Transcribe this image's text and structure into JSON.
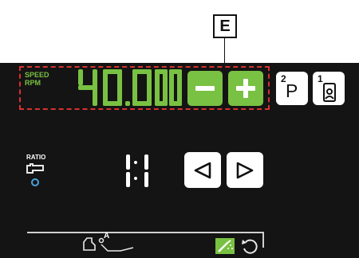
{
  "callout": {
    "label": "E"
  },
  "speed": {
    "label_line1": "SPEED",
    "label_line2": "RPM",
    "value": "40.000",
    "decrease_label": "−",
    "increase_label": "+"
  },
  "programs": [
    {
      "number": "2",
      "letter": "P",
      "icon": "program-p-icon"
    },
    {
      "number": "1",
      "icon": "user-profile-icon"
    }
  ],
  "ratio": {
    "label": "RATIO",
    "value": "1:1",
    "icon": "handpiece-icon",
    "led_color": "#4aa3df"
  },
  "footer": {
    "auto_label": "A",
    "icons": [
      "foot-control-icon",
      "reclining-chair-icon",
      "irrigation-spray-icon",
      "rotation-reverse-icon"
    ]
  },
  "colors": {
    "accent_green": "#79c142",
    "frame_red": "#d9322e",
    "panel": "#141414",
    "led_blue": "#4aa3df"
  }
}
